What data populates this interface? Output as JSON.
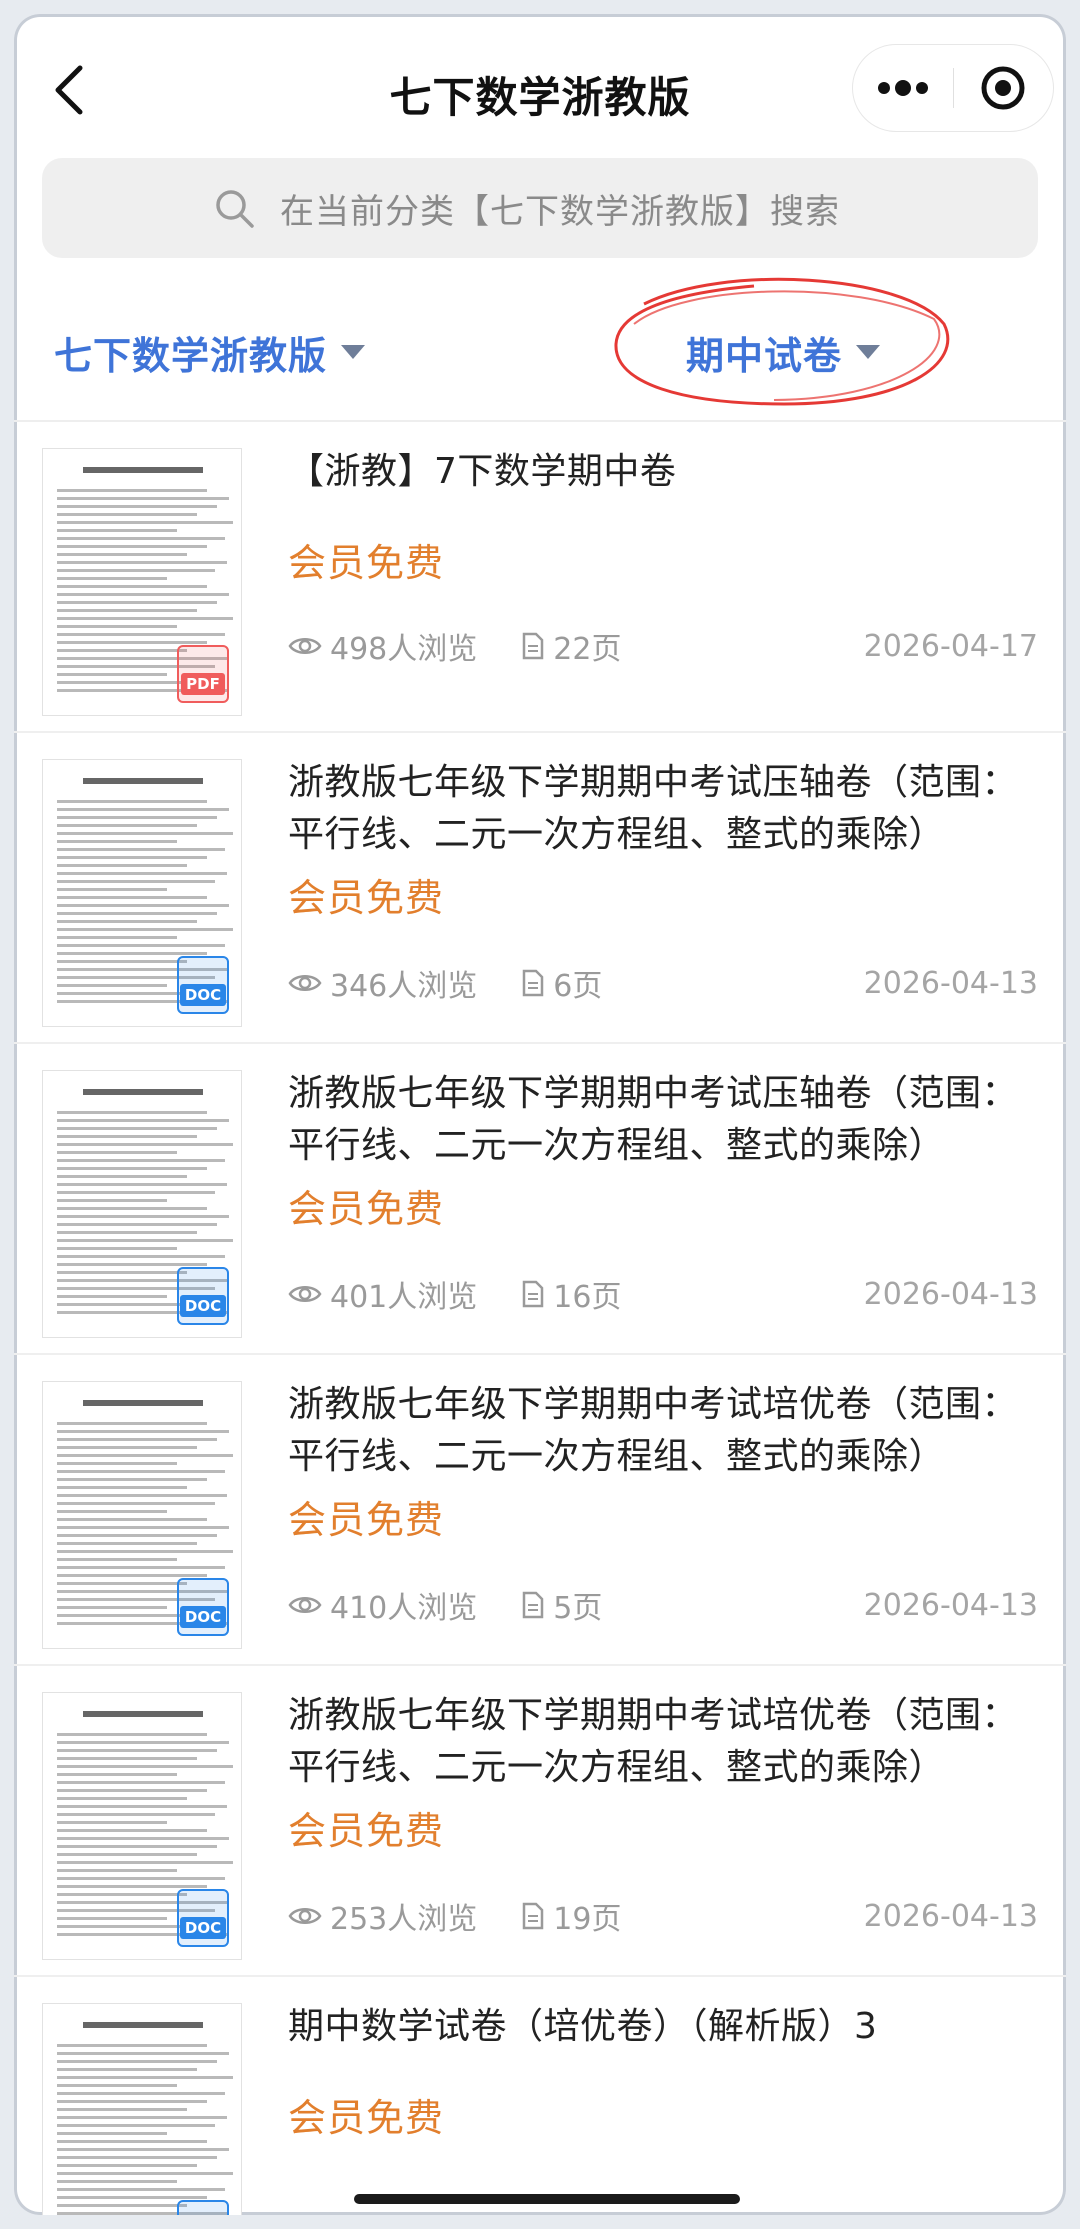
{
  "header": {
    "title": "七下数学浙教版"
  },
  "search": {
    "placeholder": "在当前分类【七下数学浙教版】搜索"
  },
  "filters": {
    "category": "七下数学浙教版",
    "type": "期中试卷"
  },
  "colors": {
    "accent": "#3f74d8",
    "price": "#e27f2d",
    "pdf_badge": "#f05c5c",
    "doc_badge": "#2a86e8",
    "annotation_circle": "#e53935"
  },
  "items": [
    {
      "title": "【浙教】7下数学期中卷",
      "price": "会员免费",
      "views": "498人浏览",
      "pages": "22页",
      "date": "2026-04-17",
      "badge": "PDF",
      "title_lines": 1
    },
    {
      "title": "浙教版七年级下学期期中考试压轴卷（范围：平行线、二元一次方程组、整式的乘除）",
      "price": "会员免费",
      "views": "346人浏览",
      "pages": "6页",
      "date": "2026-04-13",
      "badge": "DOC",
      "title_lines": 2
    },
    {
      "title": "浙教版七年级下学期期中考试压轴卷（范围：平行线、二元一次方程组、整式的乘除）",
      "price": "会员免费",
      "views": "401人浏览",
      "pages": "16页",
      "date": "2026-04-13",
      "badge": "DOC",
      "title_lines": 2
    },
    {
      "title": "浙教版七年级下学期期中考试培优卷（范围：平行线、二元一次方程组、整式的乘除）",
      "price": "会员免费",
      "views": "410人浏览",
      "pages": "5页",
      "date": "2026-04-13",
      "badge": "DOC",
      "title_lines": 2
    },
    {
      "title": "浙教版七年级下学期期中考试培优卷（范围：平行线、二元一次方程组、整式的乘除）",
      "price": "会员免费",
      "views": "253人浏览",
      "pages": "19页",
      "date": "2026-04-13",
      "badge": "DOC",
      "title_lines": 2
    },
    {
      "title": "期中数学试卷（培优卷）（解析版）3",
      "price": "会员免费",
      "views": "",
      "pages": "",
      "date": "",
      "badge": "DOC",
      "title_lines": 1
    }
  ]
}
